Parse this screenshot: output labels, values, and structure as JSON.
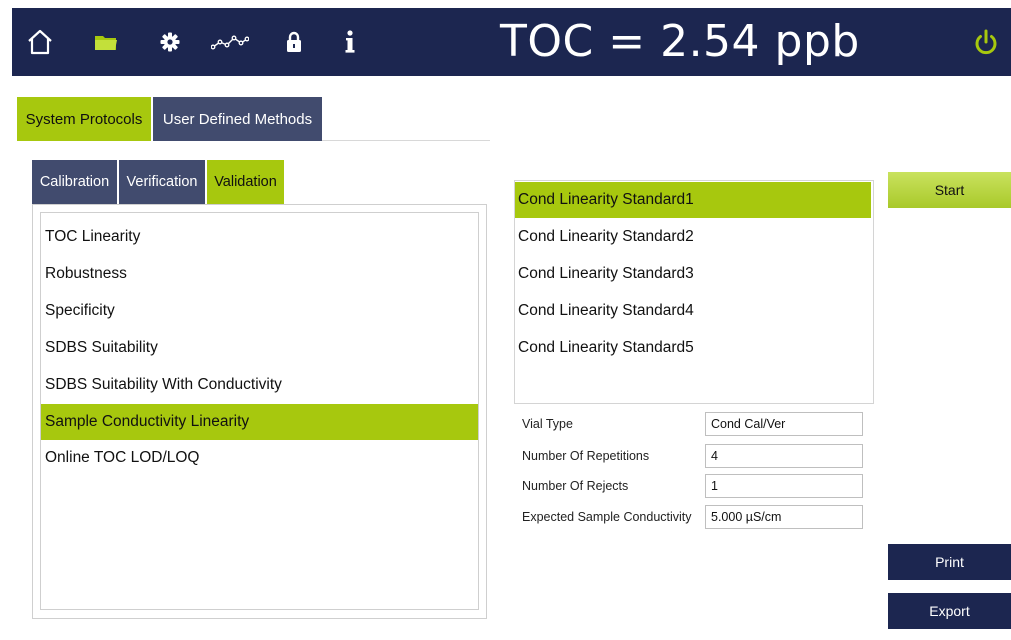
{
  "header": {
    "toc_readout": "TOC = 2.54 ppb",
    "icons": [
      "home-icon",
      "folder-icon",
      "gear-icon",
      "trend-icon",
      "lock-icon",
      "info-icon",
      "power-icon"
    ],
    "colors": {
      "bar": "#1c2650",
      "accent": "#a7c80e"
    }
  },
  "main_tabs": [
    {
      "label": "System Protocols",
      "active": true
    },
    {
      "label": "User Defined Methods",
      "active": false
    }
  ],
  "sub_tabs": [
    {
      "label": "Calibration",
      "active": false
    },
    {
      "label": "Verification",
      "active": false
    },
    {
      "label": "Validation",
      "active": true
    }
  ],
  "methods": [
    {
      "label": "TOC Linearity"
    },
    {
      "label": "Robustness"
    },
    {
      "label": "Specificity"
    },
    {
      "label": "SDBS Suitability"
    },
    {
      "label": "SDBS Suitability With Conductivity"
    },
    {
      "label": "Sample Conductivity Linearity",
      "selected": true
    },
    {
      "label": "Online TOC LOD/LOQ"
    }
  ],
  "standards": [
    {
      "label": "Cond Linearity Standard1",
      "selected": true
    },
    {
      "label": "Cond Linearity Standard2"
    },
    {
      "label": "Cond Linearity Standard3"
    },
    {
      "label": "Cond Linearity Standard4"
    },
    {
      "label": "Cond Linearity Standard5"
    }
  ],
  "params": [
    {
      "label": "Vial Type",
      "value": "Cond Cal/Ver"
    },
    {
      "label": "Number Of Repetitions",
      "value": "4"
    },
    {
      "label": "Number Of Rejects",
      "value": "1"
    },
    {
      "label": "Expected Sample Conductivity",
      "value": "5.000 µS/cm"
    }
  ],
  "buttons": {
    "start": "Start",
    "print": "Print",
    "export": "Export"
  }
}
